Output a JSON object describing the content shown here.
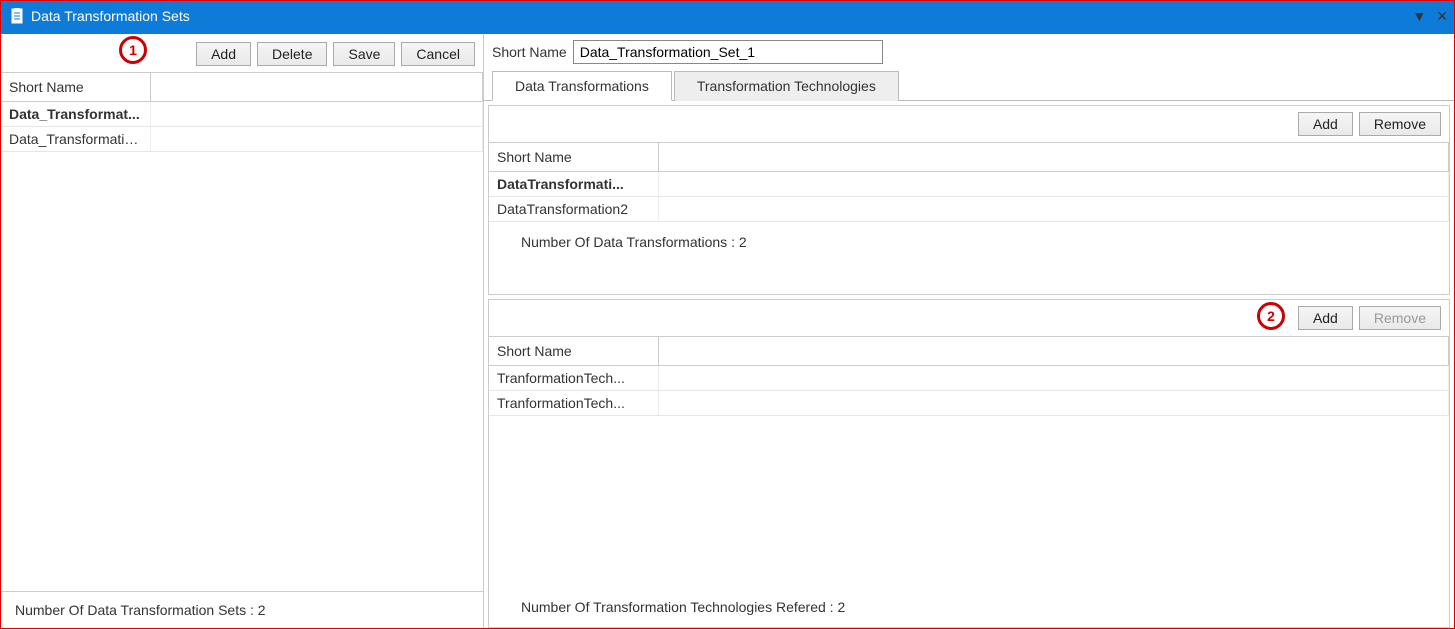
{
  "window": {
    "title": "Data Transformation Sets"
  },
  "left": {
    "buttons": {
      "add": "Add",
      "delete": "Delete",
      "save": "Save",
      "cancel": "Cancel"
    },
    "header": "Short Name",
    "rows": [
      {
        "short_name": "Data_Transformat..."
      },
      {
        "short_name": "Data_Transformatio..."
      }
    ],
    "status": "Number Of Data Transformation Sets : 2",
    "callout": "1"
  },
  "right": {
    "short_name_label": "Short Name",
    "short_name_value": "Data_Transformation_Set_1",
    "tabs": [
      {
        "label": "Data Transformations"
      },
      {
        "label": "Transformation Technologies"
      }
    ],
    "transformations": {
      "buttons": {
        "add": "Add",
        "remove": "Remove"
      },
      "header": "Short Name",
      "rows": [
        {
          "short_name": "DataTransformati..."
        },
        {
          "short_name": "DataTransformation2"
        }
      ],
      "status": "Number Of Data Transformations : 2"
    },
    "technologies": {
      "buttons": {
        "add": "Add",
        "remove": "Remove"
      },
      "header": "Short Name",
      "rows": [
        {
          "short_name": "TranformationTech..."
        },
        {
          "short_name": "TranformationTech..."
        }
      ],
      "status": "Number Of Transformation Technologies Refered : 2",
      "callout": "2"
    }
  }
}
